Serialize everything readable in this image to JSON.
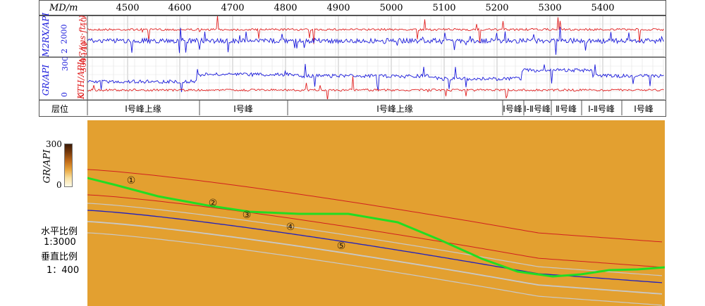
{
  "header": {
    "depth_label": "MD/m",
    "depth_ticks": [
      "4500",
      "4600",
      "4700",
      "4800",
      "4900",
      "5000",
      "5100",
      "5200",
      "5300",
      "5400"
    ]
  },
  "track1": {
    "left_label": "M2RX/API",
    "left_scale_top": "2000",
    "left_scale_bottom": "2",
    "right_label": "AC/(μs·ft⁻¹)",
    "right_scale_top": "40",
    "right_scale_bottom": "140",
    "left_color": "#1a1adb",
    "right_color": "#e02020"
  },
  "track2": {
    "left_label": "GR/API",
    "left_scale_top": "300",
    "left_scale_bottom": "0",
    "right_label": "KTH/API",
    "right_scale_top": "300",
    "right_scale_bottom": "0",
    "left_color": "#1a1adb",
    "right_color": "#e02020"
  },
  "zones": {
    "header": "层位",
    "items": [
      "Ⅰ号峰上缘",
      "Ⅰ号峰",
      "Ⅰ号峰上缘",
      "Ⅰ号峰",
      "Ⅰ-Ⅱ号峰",
      "Ⅱ号峰",
      "Ⅰ-Ⅱ号峰",
      "Ⅰ号峰"
    ]
  },
  "colorbar": {
    "label": "GR/API",
    "max": "300",
    "min": "0"
  },
  "scale": {
    "h_label": "水平比例",
    "h_value": "1:3000",
    "v_label": "垂直比例",
    "v_value": "1：400"
  },
  "markers": [
    "①",
    "②",
    "③",
    "④",
    "⑤"
  ],
  "colors": {
    "well_path": "#22dd22",
    "layer_red": "#d02020",
    "layer_blue": "#2020c0",
    "layer_grey": "#c8c8c8"
  }
}
